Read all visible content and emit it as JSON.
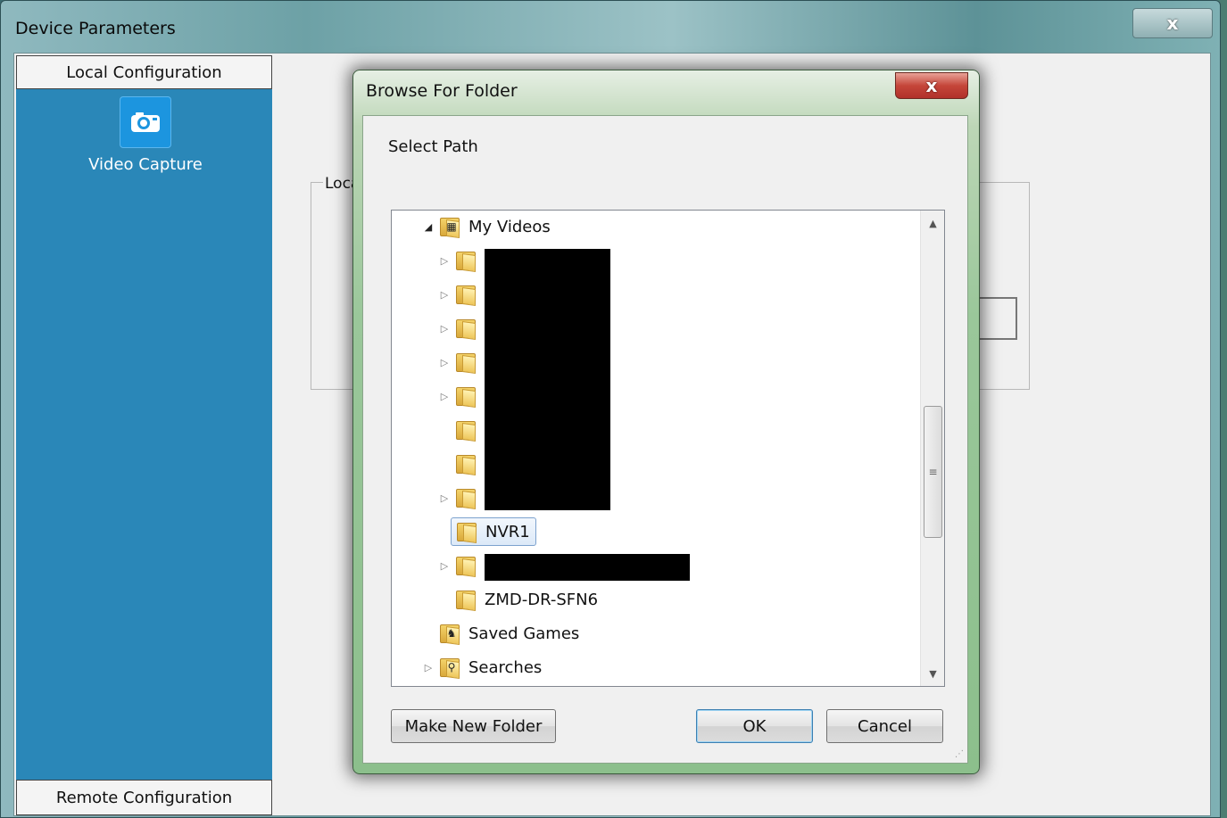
{
  "main_window": {
    "title": "Device Parameters",
    "close_label": "x",
    "sidebar": {
      "header": "Local Configuration",
      "footer": "Remote Configuration",
      "items": [
        {
          "label": "Video Capture",
          "icon": "camera-icon"
        }
      ]
    },
    "groupbox_label": "Loca"
  },
  "dialog": {
    "title": "Browse For Folder",
    "close_label": "x",
    "prompt": "Select Path",
    "tree": {
      "items": [
        {
          "label": "My Videos",
          "icon": "videos-folder-icon",
          "expander": "expanded"
        },
        {
          "label": "",
          "icon": "folder-icon",
          "expander": "collapsed",
          "redacted": true
        },
        {
          "label": "",
          "icon": "folder-icon",
          "expander": "collapsed",
          "redacted": true
        },
        {
          "label": "",
          "icon": "folder-icon",
          "expander": "collapsed",
          "redacted": true
        },
        {
          "label": "",
          "icon": "folder-icon",
          "expander": "collapsed",
          "redacted": true
        },
        {
          "label": "",
          "icon": "folder-icon",
          "expander": "collapsed",
          "redacted": true
        },
        {
          "label": "",
          "icon": "folder-icon",
          "expander": "none",
          "redacted": true
        },
        {
          "label": "",
          "icon": "folder-icon",
          "expander": "none",
          "redacted": true
        },
        {
          "label": "",
          "icon": "folder-icon",
          "expander": "collapsed",
          "redacted": true
        },
        {
          "label": "NVR1",
          "icon": "folder-icon",
          "expander": "none",
          "selected": true
        },
        {
          "label": "",
          "icon": "folder-icon",
          "expander": "collapsed",
          "redacted": true
        },
        {
          "label": "ZMD-DR-SFN6",
          "icon": "folder-icon",
          "expander": "none"
        },
        {
          "label": "Saved Games",
          "icon": "saved-games-folder-icon",
          "expander": "none"
        },
        {
          "label": "Searches",
          "icon": "searches-folder-icon",
          "expander": "collapsed"
        }
      ]
    },
    "buttons": {
      "make_new_folder": "Make New Folder",
      "ok": "OK",
      "cancel": "Cancel"
    }
  },
  "colors": {
    "sidebar_blue": "#2a87b8",
    "dialog_frame_green": "#9ac79a",
    "close_red": "#c5463a",
    "selection_border": "#7da2ce"
  }
}
